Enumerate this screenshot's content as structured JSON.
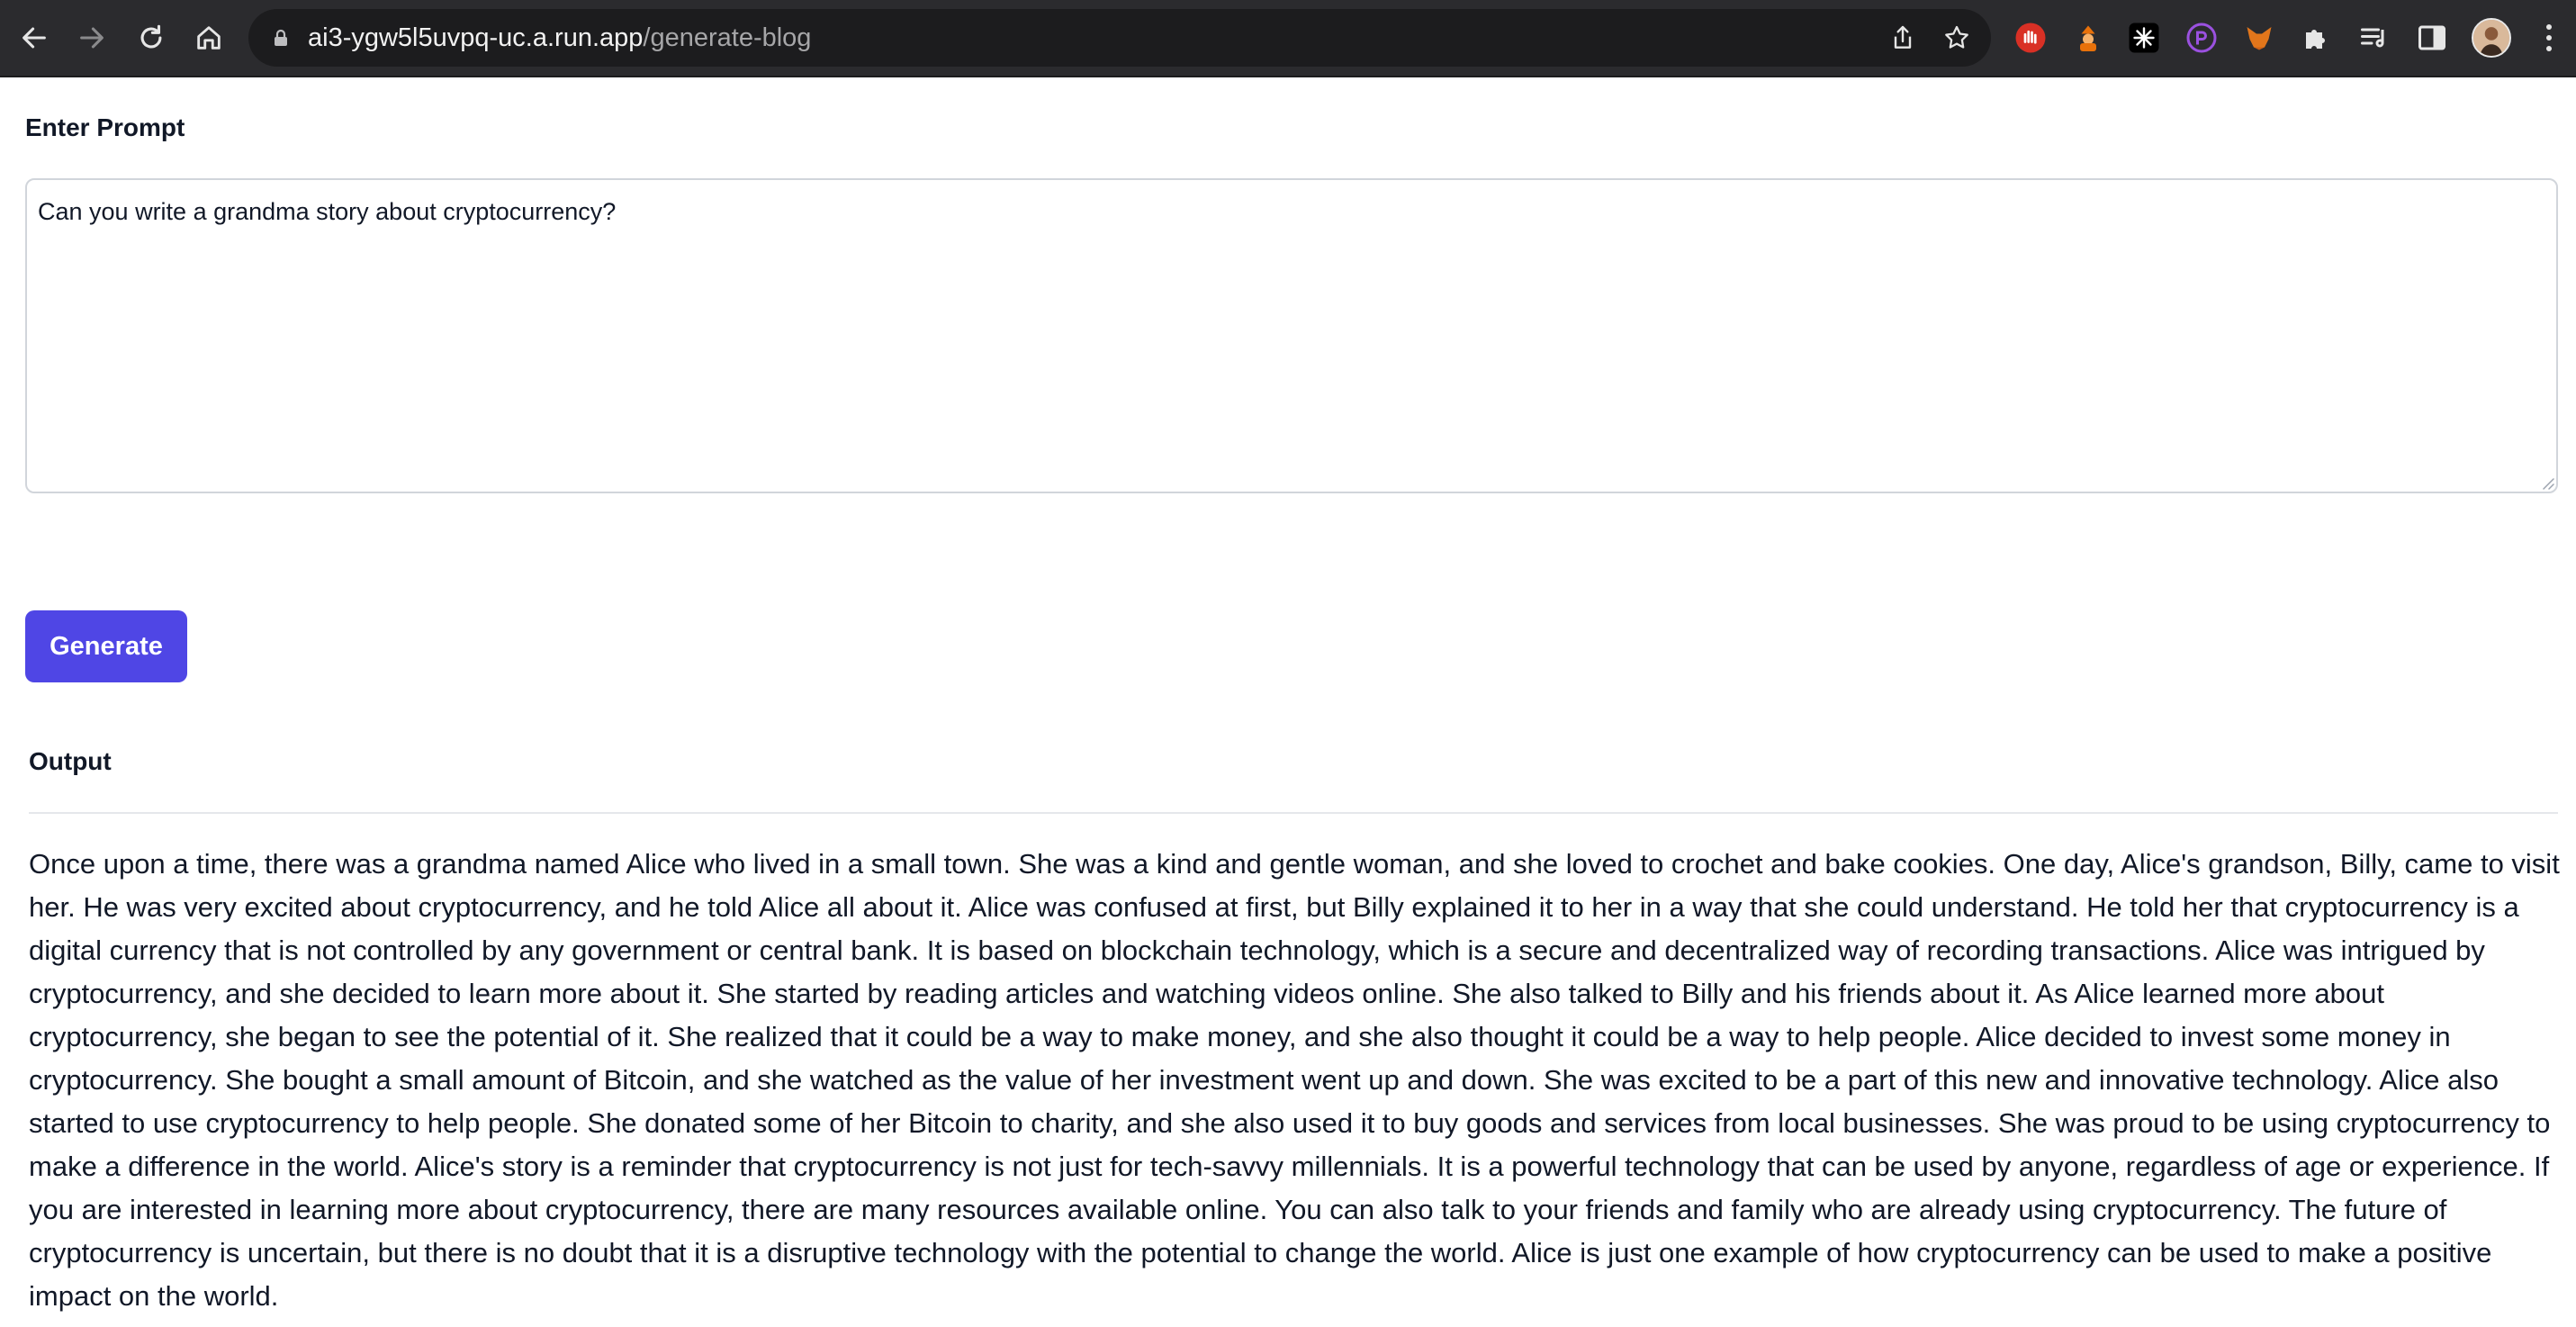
{
  "browser": {
    "url_host": "ai3-ygw5l5uvpq-uc.a.run.app",
    "url_path": "/generate-blog",
    "icons": [
      "back-arrow-icon",
      "forward-arrow-icon",
      "reload-icon",
      "home-icon",
      "lock-icon",
      "share-icon",
      "star-icon",
      "extension-icons",
      "puzzle-icon",
      "reading-list-icon",
      "side-panel-icon",
      "profile-avatar",
      "menu-icon"
    ]
  },
  "prompt": {
    "label": "Enter Prompt",
    "value": "Can you write a grandma story about cryptocurrency?"
  },
  "generate_button": {
    "label": "Generate",
    "color": "#4f46e5"
  },
  "output": {
    "label": "Output",
    "text": "Once upon a time, there was a grandma named Alice who lived in a small town. She was a kind and gentle woman, and she loved to crochet and bake cookies. One day, Alice's grandson, Billy, came to visit her. He was very excited about cryptocurrency, and he told Alice all about it. Alice was confused at first, but Billy explained it to her in a way that she could understand. He told her that cryptocurrency is a digital currency that is not controlled by any government or central bank. It is based on blockchain technology, which is a secure and decentralized way of recording transactions. Alice was intrigued by cryptocurrency, and she decided to learn more about it. She started by reading articles and watching videos online. She also talked to Billy and his friends about it. As Alice learned more about cryptocurrency, she began to see the potential of it. She realized that it could be a way to make money, and she also thought it could be a way to help people. Alice decided to invest some money in cryptocurrency. She bought a small amount of Bitcoin, and she watched as the value of her investment went up and down. She was excited to be a part of this new and innovative technology. Alice also started to use cryptocurrency to help people. She donated some of her Bitcoin to charity, and she also used it to buy goods and services from local businesses. She was proud to be using cryptocurrency to make a difference in the world. Alice's story is a reminder that cryptocurrency is not just for tech-savvy millennials. It is a powerful technology that can be used by anyone, regardless of age or experience. If you are interested in learning more about cryptocurrency, there are many resources available online. You can also talk to your friends and family who are already using cryptocurrency. The future of cryptocurrency is uncertain, but there is no doubt that it is a disruptive technology with the potential to change the world. Alice is just one example of how cryptocurrency can be used to make a positive impact on the world."
  }
}
